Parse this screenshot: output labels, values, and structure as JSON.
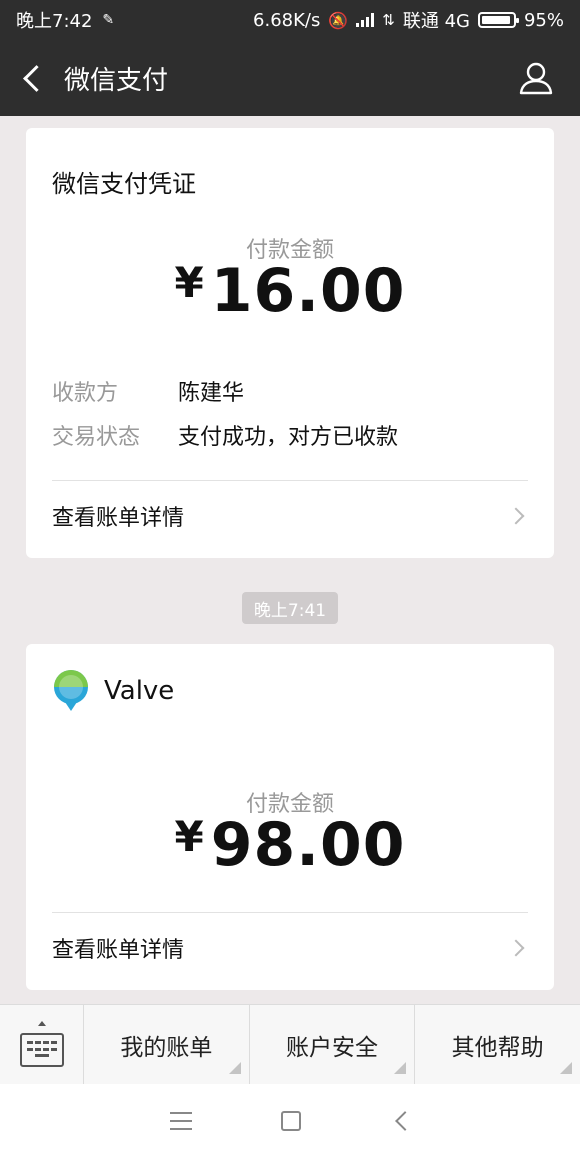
{
  "status_bar": {
    "time": "晚上7:42",
    "network_speed": "6.68K/s",
    "carrier": "联通 4G",
    "battery": "95%",
    "battery_level": 0.95
  },
  "header": {
    "title": "微信支付",
    "back_icon": "back-arrow-icon",
    "profile_icon": "person-icon"
  },
  "receipt": {
    "title": "微信支付凭证",
    "amount_label": "付款金额",
    "currency": "¥",
    "amount": "16.00",
    "rows": [
      {
        "label": "收款方",
        "value": "陈建华"
      },
      {
        "label": "交易状态",
        "value": "支付成功，对方已收款"
      }
    ],
    "detail_link": "查看账单详情"
  },
  "timestamp": "晚上7:41",
  "merchant_card": {
    "merchant": "Valve",
    "amount_label": "付款金额",
    "currency": "¥",
    "amount": "98.00",
    "detail_link": "查看账单详情"
  },
  "bottom_menu": {
    "items": [
      "我的账单",
      "账户安全",
      "其他帮助"
    ]
  },
  "colors": {
    "header": "#2e2e2e",
    "background": "#ede9ea",
    "secondary_text": "#999999"
  }
}
